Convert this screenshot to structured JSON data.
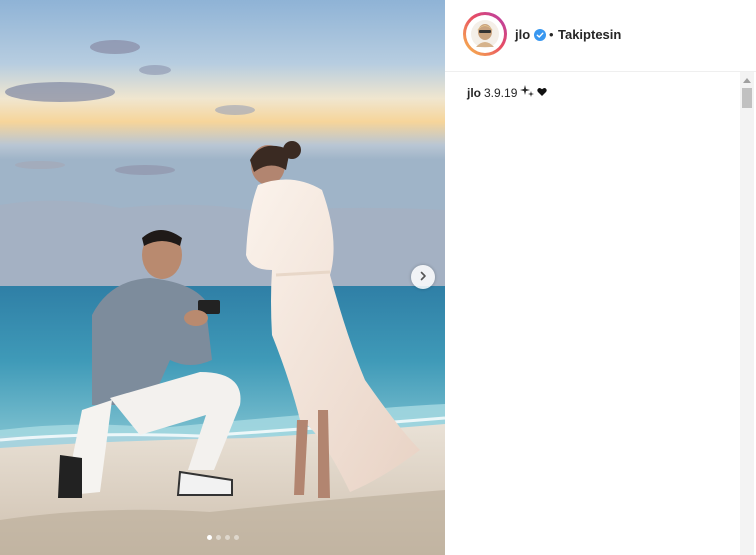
{
  "post": {
    "carousel": {
      "total_slides": 4,
      "active_slide": 1
    },
    "header": {
      "username": "jlo",
      "verified": true,
      "separator": "•",
      "follow_status": "Takiptesin"
    },
    "caption": {
      "username": "jlo",
      "text": "3.9.19",
      "emoji": [
        "sparkles-icon",
        "heart-icon"
      ]
    }
  },
  "colors": {
    "verified_blue": "#3897f0",
    "text": "#262626",
    "divider": "#efefef"
  }
}
